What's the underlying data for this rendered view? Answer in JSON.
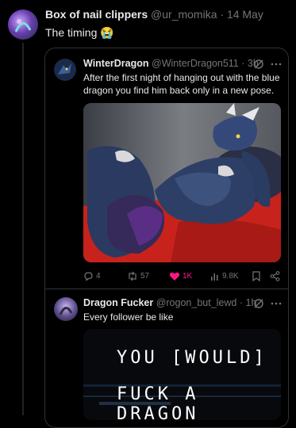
{
  "outer_post": {
    "display_name": "Box of nail clippers",
    "handle": "@ur_momika",
    "separator": "·",
    "date": "14 May",
    "text": "The timing",
    "emoji": "😭"
  },
  "quoted_post": {
    "display_name": "WinterDragon",
    "handle": "@WinterDragon511",
    "separator": "·",
    "time": "3h",
    "text": "After the first night of hanging out with the blue dragon you find him back only in a new pose.",
    "actions": {
      "replies": "4",
      "reposts": "57",
      "likes": "1K",
      "views": "9.8K"
    }
  },
  "reply_post": {
    "display_name": "Dragon Fucker",
    "handle": "@rogon_but_lewd",
    "separator": "·",
    "time": "1h",
    "text": "Every follower be like",
    "media_text_line1": "YOU [WOULD]",
    "media_text_line2": "FUCK A DRAGON"
  },
  "colors": {
    "background": "#000000",
    "text_primary": "#e7e9ea",
    "text_muted": "#71767b",
    "like_pink": "#f91880",
    "border": "#2f3336"
  },
  "icons": [
    "grok-icon",
    "more-icon",
    "reply-icon",
    "repost-icon",
    "like-icon",
    "views-icon",
    "bookmark-icon",
    "share-icon"
  ]
}
